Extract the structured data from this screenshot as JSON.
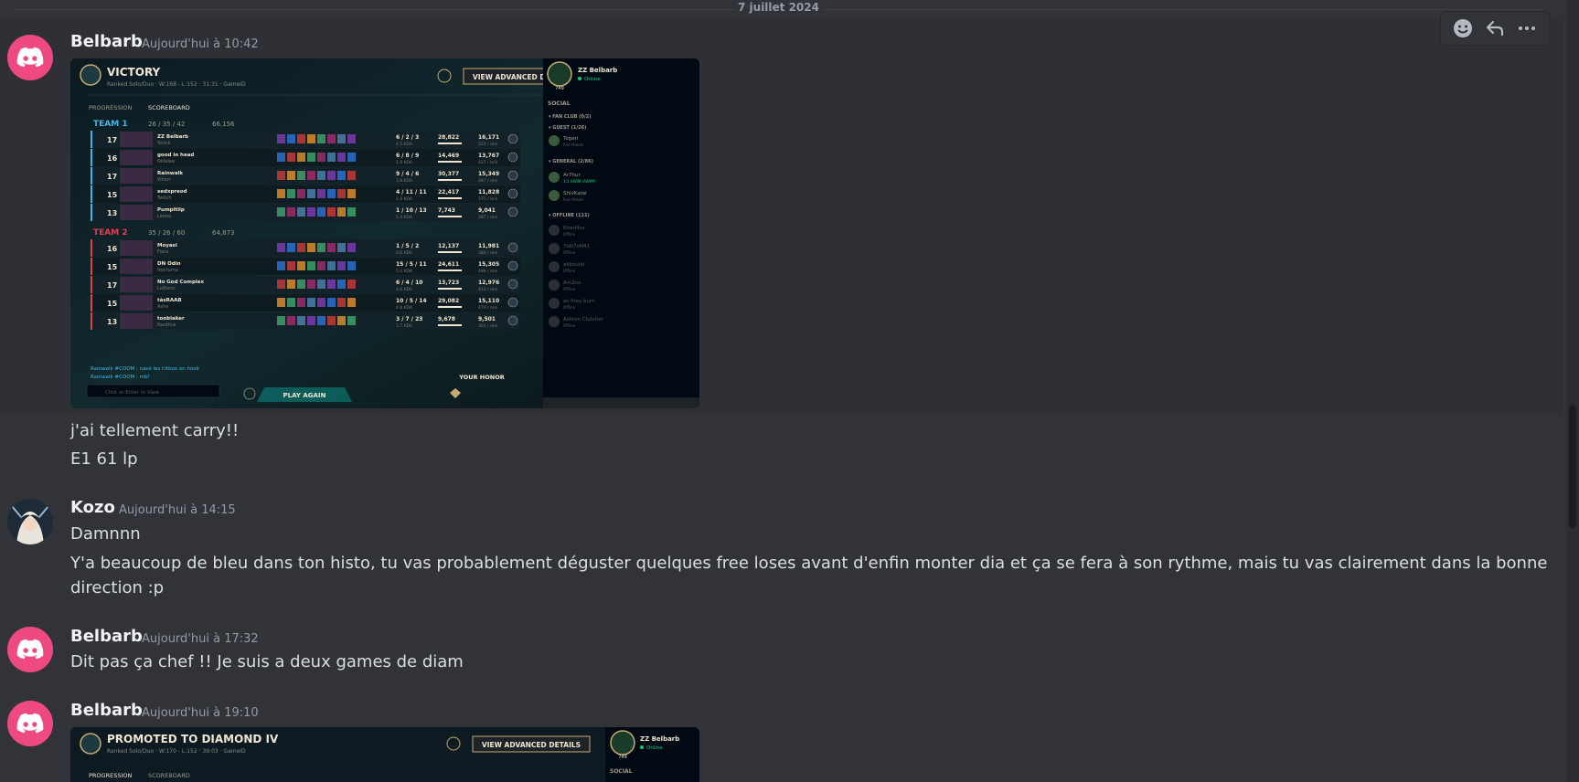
{
  "date_divider": "7 juillet 2024",
  "toolbar": {
    "icons": [
      "add-reaction-icon",
      "reply-icon",
      "more-icon"
    ]
  },
  "messages": [
    {
      "author": "Belbarb",
      "time": "Aujourd'hui à 10:42",
      "lines": [
        "j'ai tellement carry!!",
        "E1 61 lp"
      ]
    },
    {
      "author": "Kozo",
      "time": "Aujourd'hui à 14:15",
      "lines": [
        "Damnnn",
        "Y'a beaucoup de bleu dans ton histo, tu vas probablement déguster quelques free loses avant d'enfin monter dia et ça se fera à son rythme, mais tu vas clairement dans la bonne",
        "direction :p"
      ]
    },
    {
      "author": "Belbarb",
      "time": "Aujourd'hui à 17:32",
      "lines": [
        "Dit pas ça chef !! Je suis a deux games de diam"
      ]
    },
    {
      "author": "Belbarb",
      "time": "Aujourd'hui à 19:10",
      "lines": []
    }
  ],
  "game1": {
    "title": "VICTORY",
    "subtitle": "Ranked Solo/Duo  ·  W:168 - L:152  ·  31:31  ·  GameID",
    "advanced_btn": "VIEW ADVANCED DETAILS",
    "tabs": [
      "PROGRESSION",
      "SCOREBOARD"
    ],
    "team1": {
      "label": "TEAM 1",
      "kda": "26 / 35 / 42",
      "gold": "66,156"
    },
    "team2": {
      "label": "TEAM 2",
      "kda": "35 / 26 / 60",
      "gold": "64,873"
    },
    "players_t1": [
      {
        "lvl": "17",
        "name": "ZZ Belbarb",
        "champ": "Yorick",
        "kda": "6 / 2 / 3",
        "ratio": "4.5 KDA",
        "dmg": "28,822",
        "gold": "16,171",
        "gpm": "522 / min"
      },
      {
        "lvl": "16",
        "name": "good in head",
        "champ": "Nidalee",
        "kda": "6 / 8 / 9",
        "ratio": "1.9 KDA",
        "dmg": "14,469",
        "gold": "13,767",
        "gpm": "437 / min"
      },
      {
        "lvl": "17",
        "name": "Rainwalk",
        "champ": "Viktor",
        "kda": "9 / 4 / 6",
        "ratio": "3.8 KDA",
        "dmg": "30,377",
        "gold": "15,349",
        "gpm": "487 / min"
      },
      {
        "lvl": "15",
        "name": "sedxpreod",
        "champ": "Twitch",
        "kda": "4 / 11 / 11",
        "ratio": "1.4 KDA",
        "dmg": "22,417",
        "gold": "11,828",
        "gpm": "375 / min"
      },
      {
        "lvl": "13",
        "name": "Pumpltilp",
        "champ": "Leona",
        "kda": "1 / 10 / 13",
        "ratio": "1.4 KDA",
        "dmg": "7,743",
        "gold": "9,041",
        "gpm": "287 / min"
      }
    ],
    "players_t2": [
      {
        "lvl": "16",
        "name": "Moyasi",
        "champ": "Fiora",
        "kda": "1 / 5 / 2",
        "ratio": "0.6 KDA",
        "dmg": "12,137",
        "gold": "11,981",
        "gpm": "380 / min"
      },
      {
        "lvl": "15",
        "name": "DN Odin",
        "champ": "Nocturne",
        "kda": "15 / 5 / 11",
        "ratio": "5.2 KDA",
        "dmg": "24,611",
        "gold": "15,305",
        "gpm": "486 / min"
      },
      {
        "lvl": "17",
        "name": "No God Complex",
        "champ": "LeBlanc",
        "kda": "6 / 4 / 10",
        "ratio": "4.0 KDA",
        "dmg": "13,723",
        "gold": "12,976",
        "gpm": "412 / min"
      },
      {
        "lvl": "15",
        "name": "tàsRAAB",
        "champ": "Ashe",
        "kda": "10 / 5 / 14",
        "ratio": "4.8 KDA",
        "dmg": "29,082",
        "gold": "15,110",
        "gpm": "479 / min"
      },
      {
        "lvl": "13",
        "name": "tooblaker",
        "champ": "Nautilus",
        "kda": "3 / 7 / 23",
        "ratio": "3.7 KDA",
        "dmg": "9,678",
        "gold": "9,501",
        "gpm": "301 / min"
      }
    ],
    "chat": [
      "Rainwalk #COOM : nasé les hitbox on hook",
      "Rainwalk #COOM : mb!"
    ],
    "chat_input": "Click or Enter to View",
    "play_again": "PLAY AGAIN",
    "honor": "YOUR HONOR",
    "profile": {
      "name": "ZZ Belbarb",
      "status": "Online",
      "level": "749"
    },
    "social": {
      "label": "SOCIAL",
      "groups": [
        "FAN CLUB (0/2)",
        "GUEST (1/26)",
        "GENERAL (2/86)",
        "OFFLINE (111)"
      ],
      "friends": [
        {
          "name": "Togari",
          "status": "Riot Mobile"
        },
        {
          "name": "Ar7hur",
          "status": "1/1 ARAM (ARAM)"
        },
        {
          "name": "ShivKatal",
          "status": "Riot Mobile"
        },
        {
          "name": "Kharillos",
          "status": "Offline"
        },
        {
          "name": "7oN7oN41",
          "status": "Offline"
        },
        {
          "name": "akboulbi",
          "status": "Offline"
        },
        {
          "name": "Am3no",
          "status": "Offline"
        },
        {
          "name": "as they burn",
          "status": "Offline"
        },
        {
          "name": "Ashton Clutcher",
          "status": "Offline"
        }
      ]
    }
  },
  "game2": {
    "title": "PROMOTED TO DIAMOND IV",
    "subtitle": "Ranked Solo/Duo  ·  W:170 - L:152  ·  39:03  ·  GameID",
    "advanced_btn": "VIEW ADVANCED DETAILS",
    "tabs": [
      "PROGRESSION",
      "SCOREBOARD"
    ],
    "profile": {
      "name": "ZZ Belbarb",
      "status": "Online",
      "level": "749"
    },
    "social_label": "SOCIAL"
  },
  "colors": {
    "discord_avatar": "#ee4a81",
    "team1": "#3fb7e7",
    "team2": "#e23f55",
    "gold_accent": "#c8aa6e"
  }
}
